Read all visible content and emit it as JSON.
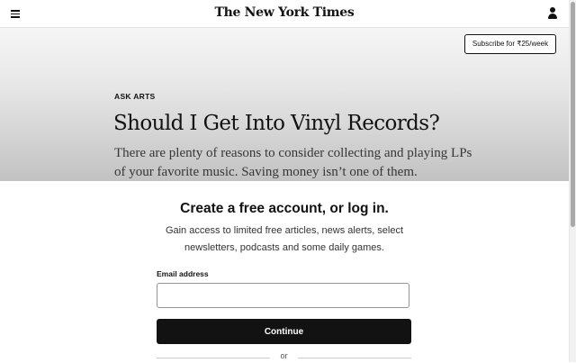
{
  "header": {
    "logo": "The New York Times",
    "menu_icon": "hamburger-menu-icon",
    "account_icon": "user-account-icon"
  },
  "subscribe": {
    "label": "Subscribe for ₹25/week"
  },
  "article": {
    "kicker": "ASK ARTS",
    "headline": "Should I Get Into Vinyl Records?",
    "summary": "There are plenty of reasons to consider collecting and playing LPs of your favorite music. Saving money isn’t one of them."
  },
  "modal": {
    "title": "Create a free account, or log in.",
    "description": "Gain access to limited free articles, news alerts, select newsletters, podcasts and some daily games.",
    "email_label": "Email address",
    "email_value": "",
    "email_placeholder": "",
    "continue_label": "Continue",
    "divider_text": "or"
  },
  "colors": {
    "text": "#121212",
    "button_bg": "#121212",
    "button_text": "#ffffff",
    "input_border": "#959595"
  }
}
